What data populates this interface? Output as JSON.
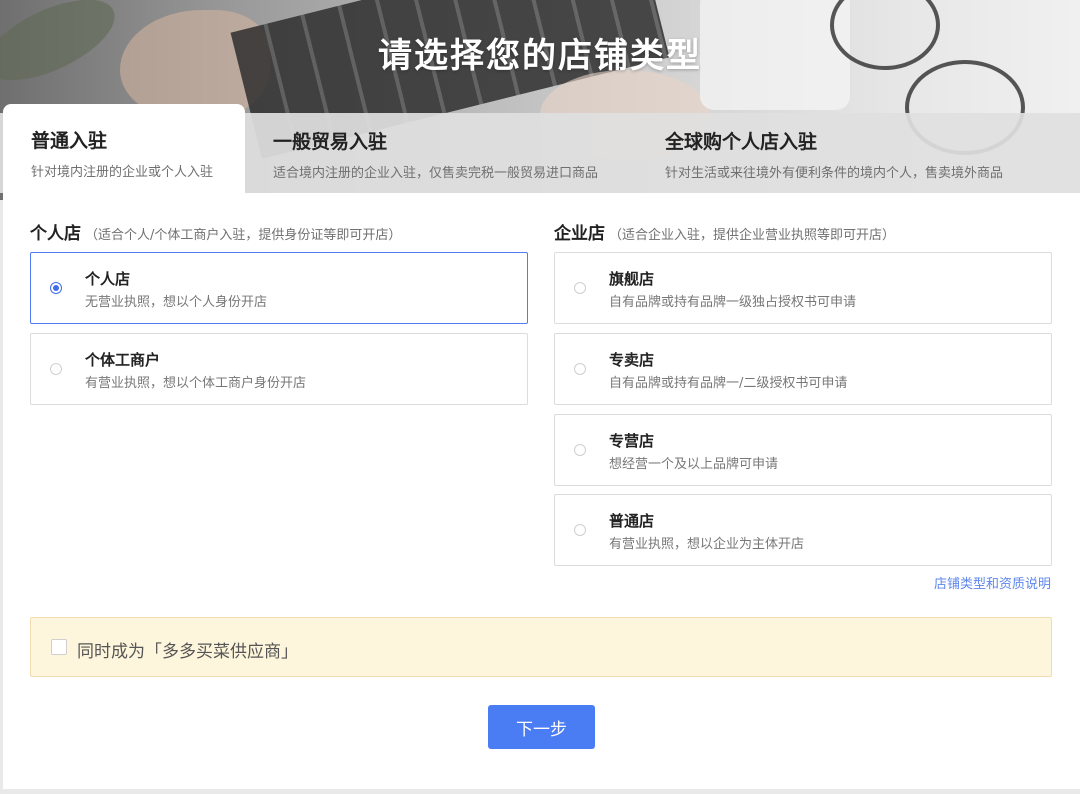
{
  "hero": {
    "title": "请选择您的店铺类型"
  },
  "tabs": [
    {
      "title": "普通入驻",
      "subtitle": "针对境内注册的企业或个人入驻"
    },
    {
      "title": "一般贸易入驻",
      "subtitle": "适合境内注册的企业入驻，仅售卖完税一般贸易进口商品"
    },
    {
      "title": "全球购个人店入驻",
      "subtitle": "针对生活或来往境外有便利条件的境内个人，售卖境外商品"
    }
  ],
  "personal": {
    "heading": "个人店",
    "hint": "（适合个人/个体工商户入驻，提供身份证等即可开店）",
    "options": [
      {
        "title": "个人店",
        "desc": "无营业执照，想以个人身份开店"
      },
      {
        "title": "个体工商户",
        "desc": "有营业执照，想以个体工商户身份开店"
      }
    ]
  },
  "enterprise": {
    "heading": "企业店",
    "hint": "（适合企业入驻，提供企业营业执照等即可开店）",
    "options": [
      {
        "title": "旗舰店",
        "desc": "自有品牌或持有品牌一级独占授权书可申请"
      },
      {
        "title": "专卖店",
        "desc": "自有品牌或持有品牌一/二级授权书可申请"
      },
      {
        "title": "专营店",
        "desc": "想经营一个及以上品牌可申请"
      },
      {
        "title": "普通店",
        "desc": "有营业执照，想以企业为主体开店"
      }
    ]
  },
  "help_link": "店铺类型和资质说明",
  "supplier": {
    "label": "同时成为「多多买菜供应商」"
  },
  "next_button": "下一步",
  "colors": {
    "accent": "#4a7cf3",
    "selected_border": "#4f7cf2",
    "notice_bg": "#fef6dc"
  }
}
